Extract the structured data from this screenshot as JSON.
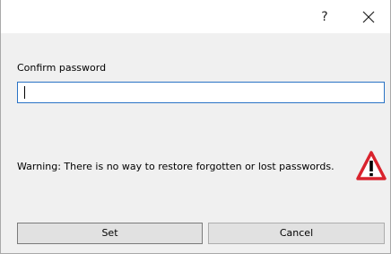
{
  "window": {
    "help_label": "?",
    "close_icon": "close-icon"
  },
  "form": {
    "confirm_label": "Confirm password",
    "password_value": "",
    "warning_text": "Warning: There is no way to restore forgotten or lost passwords.",
    "warning_icon": "warning-triangle-icon"
  },
  "buttons": {
    "set": "Set",
    "cancel": "Cancel"
  },
  "colors": {
    "input_focus_border": "#2a73c5",
    "warning_red": "#d9232d"
  }
}
